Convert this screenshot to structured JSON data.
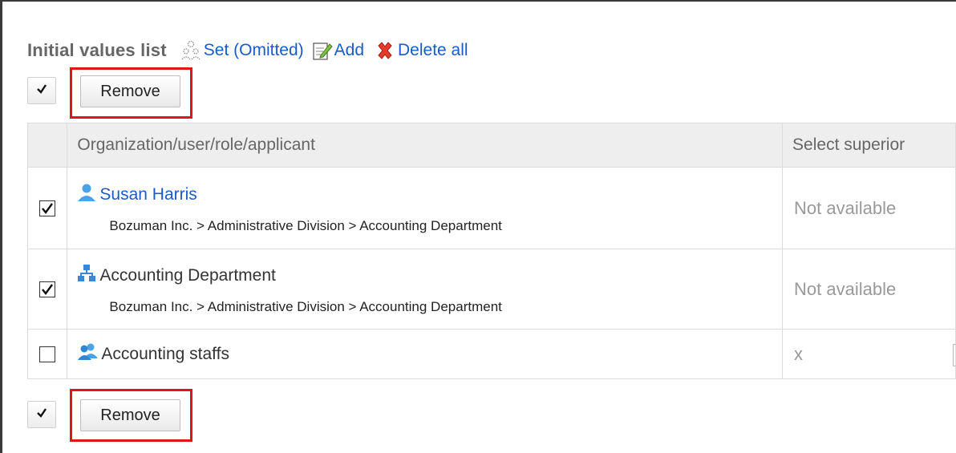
{
  "header": {
    "title": "Initial values list",
    "set_label": "Set (Omitted)",
    "add_label": "Add",
    "delete_all_label": "Delete all"
  },
  "toolbar": {
    "remove_label": "Remove"
  },
  "table": {
    "col_name": "Organization/user/role/applicant",
    "col_superior": "Select superior",
    "rows": [
      {
        "icon": "user-icon",
        "name": "Susan Harris",
        "path": "Bozuman Inc. > Administrative Division > Accounting Department",
        "superior": "Not available",
        "checked": true
      },
      {
        "icon": "organization-icon",
        "name": "Accounting Department",
        "path": "Bozuman Inc. > Administrative Division > Accounting Department",
        "superior": "Not available",
        "checked": true
      },
      {
        "icon": "role-icon",
        "name": "Accounting staffs",
        "superior": "x",
        "checked": false
      }
    ]
  },
  "colors": {
    "link": "#1a5bc8",
    "highlight": "#e0151a"
  }
}
